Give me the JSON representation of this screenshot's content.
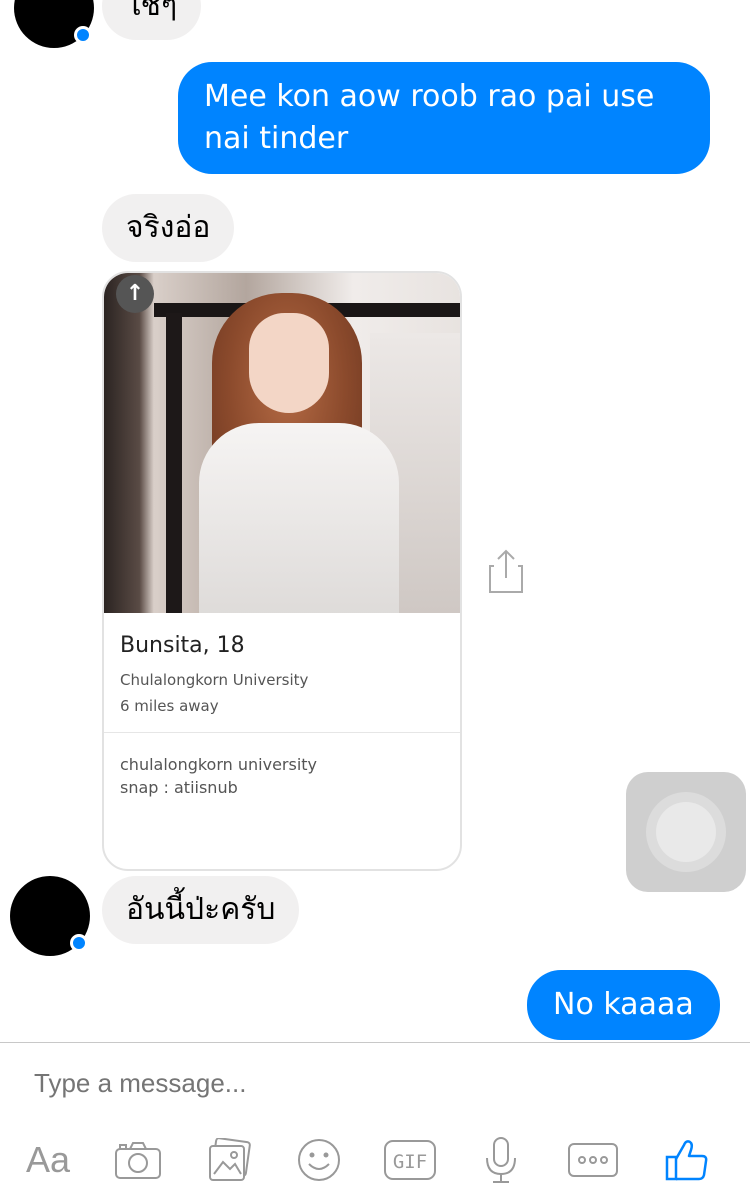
{
  "conversation": {
    "messages": [
      {
        "from": "them",
        "text": "ใช่ๆ"
      },
      {
        "from": "me",
        "text": "Mee kon aow roob rao pai use nai tinder"
      },
      {
        "from": "them",
        "text": "จริงอ่อ"
      },
      {
        "from": "them",
        "text": "อันนี้ป่ะครับ"
      },
      {
        "from": "me",
        "text": "No kaaaa"
      }
    ]
  },
  "profile_card": {
    "name": "Bunsita, 18",
    "school": "Chulalongkorn University",
    "distance": "6 miles away",
    "bio": "chulalongkorn university\nsnap : atiisnub"
  },
  "composer": {
    "placeholder": "Type a message..."
  },
  "toolbar": {
    "aa_label": "Aa",
    "gif_label": "GIF",
    "icons": [
      "camera-icon",
      "gallery-icon",
      "emoji-icon",
      "gif-icon",
      "microphone-icon",
      "more-icon",
      "like-icon"
    ]
  },
  "colors": {
    "outgoing_bubble": "#0084ff",
    "incoming_bubble": "#f1f0f0",
    "online_dot": "#0084ff",
    "like_icon": "#0084ff"
  }
}
